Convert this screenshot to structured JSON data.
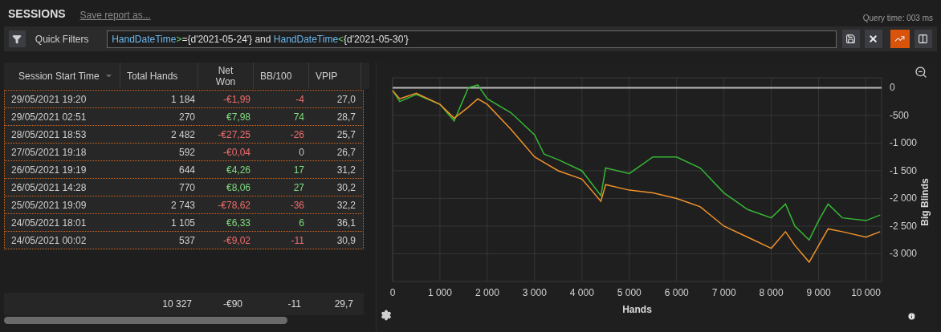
{
  "header": {
    "title": "SESSIONS",
    "save_link": "Save report as...",
    "query_time": "Query time: 003 ms"
  },
  "toolbar": {
    "quick_filters": "Quick Filters",
    "filter": [
      {
        "kind": "field",
        "text": "HandDateTime"
      },
      {
        "kind": "operator",
        "text": ">"
      },
      {
        "kind": "text",
        "text": "={d'2021-05-24'} and "
      },
      {
        "kind": "field",
        "text": "HandDateTime"
      },
      {
        "kind": "operator",
        "text": "<"
      },
      {
        "kind": "text",
        "text": "{d'2021-05-30'}"
      }
    ],
    "buttons": [
      {
        "kind": "save",
        "selected": false
      },
      {
        "kind": "clear",
        "selected": false
      },
      {
        "kind": "chart",
        "selected": true
      },
      {
        "kind": "columns",
        "selected": false
      }
    ]
  },
  "table": {
    "columns": [
      {
        "label": "Session Start Time",
        "sorted": true
      },
      {
        "label": "Total Hands",
        "sorted": false
      },
      {
        "label": "Net Won",
        "sorted": false
      },
      {
        "label": "BB/100",
        "sorted": false
      },
      {
        "label": "VPIP",
        "sorted": false
      }
    ],
    "rows": [
      {
        "start": "29/05/2021 19:20",
        "hands": "1 184",
        "net_won": {
          "text": "-€1,99",
          "color": "#ef6b6b"
        },
        "bb100": {
          "text": "-4",
          "color": "#ef6b6b"
        },
        "vpip": "27,0"
      },
      {
        "start": "29/05/2021 02:51",
        "hands": "270",
        "net_won": {
          "text": "€7,98",
          "color": "#7fdc7f"
        },
        "bb100": {
          "text": "74",
          "color": "#7fdc7f"
        },
        "vpip": "28,7"
      },
      {
        "start": "28/05/2021 18:53",
        "hands": "2 482",
        "net_won": {
          "text": "-€27,25",
          "color": "#ef6b6b"
        },
        "bb100": {
          "text": "-26",
          "color": "#ef6b6b"
        },
        "vpip": "25,7"
      },
      {
        "start": "27/05/2021 19:18",
        "hands": "592",
        "net_won": {
          "text": "-€0,04",
          "color": "#ef6b6b"
        },
        "bb100": {
          "text": "0",
          "color": "#c8c8c8"
        },
        "vpip": "26,7"
      },
      {
        "start": "26/05/2021 19:19",
        "hands": "644",
        "net_won": {
          "text": "€4,26",
          "color": "#7fdc7f"
        },
        "bb100": {
          "text": "17",
          "color": "#7fdc7f"
        },
        "vpip": "31,2"
      },
      {
        "start": "26/05/2021 14:28",
        "hands": "770",
        "net_won": {
          "text": "€8,06",
          "color": "#7fdc7f"
        },
        "bb100": {
          "text": "27",
          "color": "#7fdc7f"
        },
        "vpip": "30,2"
      },
      {
        "start": "25/05/2021 19:09",
        "hands": "2 743",
        "net_won": {
          "text": "-€78,62",
          "color": "#ef6b6b"
        },
        "bb100": {
          "text": "-36",
          "color": "#ef6b6b"
        },
        "vpip": "32,2"
      },
      {
        "start": "24/05/2021 18:01",
        "hands": "1 105",
        "net_won": {
          "text": "€6,33",
          "color": "#7fdc7f"
        },
        "bb100": {
          "text": "6",
          "color": "#7fdc7f"
        },
        "vpip": "36,1"
      },
      {
        "start": "24/05/2021 00:02",
        "hands": "537",
        "net_won": {
          "text": "-€9,02",
          "color": "#ef6b6b"
        },
        "bb100": {
          "text": "-11",
          "color": "#ef6b6b"
        },
        "vpip": "30,9"
      }
    ],
    "totals": {
      "hands": "10 327",
      "net_won": "-€90",
      "bb100": "-11",
      "vpip": "29,7"
    }
  },
  "chart": {
    "chart_data": {
      "type": "line",
      "grid": true,
      "xlabel": "Hands",
      "ylabel": "Big Blinds",
      "x": [
        0,
        150,
        500,
        1000,
        1300,
        1600,
        1800,
        2000,
        2500,
        3000,
        3200,
        3500,
        4000,
        4400,
        4500,
        5000,
        5500,
        6000,
        6500,
        7000,
        7500,
        8000,
        8300,
        8500,
        8800,
        9000,
        9200,
        9500,
        10000,
        10300
      ],
      "series": [
        {
          "color": "#35b835",
          "values": [
            -50,
            -250,
            -120,
            -300,
            -600,
            0,
            50,
            -200,
            -450,
            -850,
            -1200,
            -1300,
            -1500,
            -1950,
            -1450,
            -1550,
            -1250,
            -1250,
            -1450,
            -1900,
            -2200,
            -2350,
            -2100,
            -2500,
            -2750,
            -2400,
            -2100,
            -2350,
            -2400,
            -2300
          ]
        },
        {
          "color": "#f0922b",
          "values": [
            -50,
            -200,
            -100,
            -300,
            -550,
            -350,
            -200,
            -300,
            -750,
            -1250,
            -1350,
            -1500,
            -1650,
            -2050,
            -1750,
            -1850,
            -1900,
            -2000,
            -2150,
            -2500,
            -2700,
            -2900,
            -2600,
            -2850,
            -3150,
            -2850,
            -2550,
            -2600,
            -2700,
            -2600
          ]
        }
      ],
      "xlim": [
        0,
        10330
      ],
      "ylim": [
        -3500,
        180
      ],
      "xticks": [
        {
          "value": 0,
          "label": "0"
        },
        {
          "value": 1000,
          "label": "1 000"
        },
        {
          "value": 2000,
          "label": "2 000"
        },
        {
          "value": 3000,
          "label": "3 000"
        },
        {
          "value": 4000,
          "label": "4 000"
        },
        {
          "value": 5000,
          "label": "5 000"
        },
        {
          "value": 6000,
          "label": "6 000"
        },
        {
          "value": 7000,
          "label": "7 000"
        },
        {
          "value": 8000,
          "label": "8 000"
        },
        {
          "value": 9000,
          "label": "9 000"
        },
        {
          "value": 10000,
          "label": "10 000"
        }
      ],
      "yticks": [
        {
          "value": 0,
          "label": "0"
        },
        {
          "value": -500,
          "label": "-500"
        },
        {
          "value": -1000,
          "label": "-1 000"
        },
        {
          "value": -1500,
          "label": "-1 500"
        },
        {
          "value": -2000,
          "label": "-2 000"
        },
        {
          "value": -2500,
          "label": "-2 500"
        },
        {
          "value": -3000,
          "label": "-3 000"
        }
      ]
    }
  }
}
